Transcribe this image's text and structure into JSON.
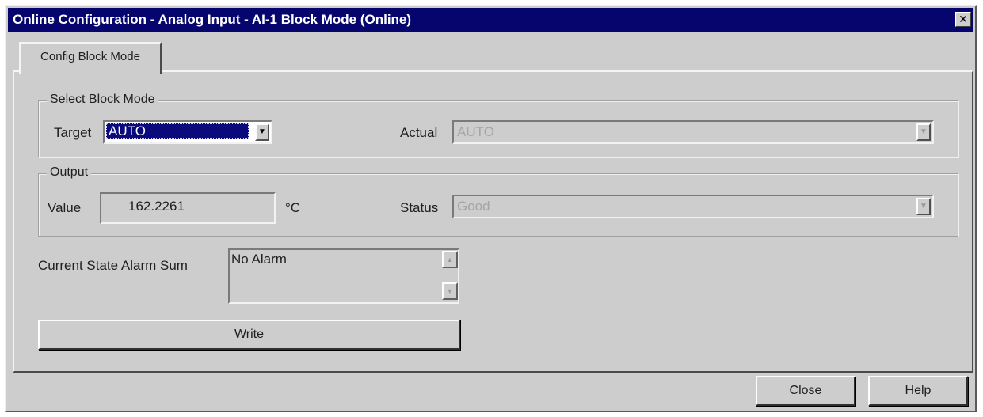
{
  "window": {
    "title": "Online Configuration - Analog Input - AI-1 Block Mode  (Online)",
    "close_glyph": "✕"
  },
  "tabs": [
    {
      "label": "Config Block Mode",
      "active": true
    }
  ],
  "select_block_mode": {
    "group_label": "Select Block Mode",
    "target_label": "Target",
    "target_value": "AUTO",
    "actual_label": "Actual",
    "actual_value": "AUTO"
  },
  "output": {
    "group_label": "Output",
    "value_label": "Value",
    "value": "162.2261",
    "unit": "°C",
    "status_label": "Status",
    "status_value": "Good"
  },
  "alarm": {
    "label": "Current State Alarm Sum",
    "value": "No Alarm"
  },
  "buttons": {
    "write": "Write",
    "close": "Close",
    "help": "Help"
  },
  "icons": {
    "dropdown": "chevron-down-icon",
    "scroll_up": "arrow-up-icon",
    "scroll_down": "arrow-down-icon",
    "close": "close-icon"
  },
  "colors": {
    "titlebar": "#06056e",
    "face": "#cdcdcd",
    "selection": "#0a0a7c"
  }
}
